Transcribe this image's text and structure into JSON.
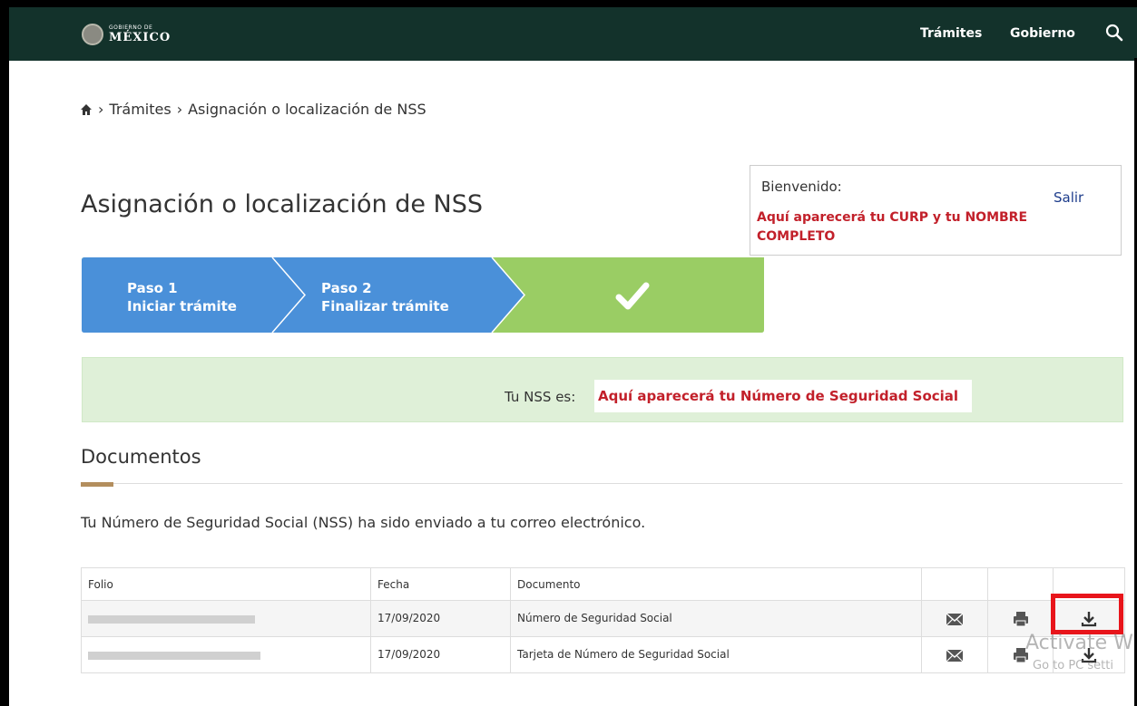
{
  "header": {
    "logo_small": "GOBIERNO DE",
    "logo_big": "MÉXICO",
    "nav": [
      "Trámites",
      "Gobierno"
    ],
    "search_icon": "search-icon",
    "colors": {
      "navbar": "#13322b",
      "accent": "#b38e5d"
    }
  },
  "breadcrumb": {
    "home_icon": "home-icon",
    "items": [
      "Trámites",
      "Asignación o localización de NSS"
    ]
  },
  "page": {
    "title": "Asignación o localización de NSS"
  },
  "welcome": {
    "label": "Bienvenido:",
    "logout": "Salir",
    "placeholder": "Aquí aparecerá tu CURP y tu NOMBRE COMPLETO"
  },
  "stepper": {
    "steps": [
      {
        "number": "Paso 1",
        "label": "Iniciar trámite",
        "color": "#4a90d9"
      },
      {
        "number": "Paso 2",
        "label": "Finalizar trámite",
        "color": "#4a90d9"
      },
      {
        "label": "",
        "icon": "checkmark-icon",
        "color": "#9acd64"
      }
    ]
  },
  "nss": {
    "label": "Tu NSS es:",
    "value_placeholder": "Aquí aparecerá tu Número de Seguridad Social"
  },
  "documents": {
    "title": "Documentos",
    "notice": "Tu Número de Seguridad Social (NSS) ha sido enviado a tu correo electrónico.",
    "headers": [
      "Folio",
      "Fecha",
      "Documento"
    ],
    "rows": [
      {
        "folio": "",
        "fecha": "17/09/2020",
        "documento": "Número de Seguridad Social"
      },
      {
        "folio": "",
        "fecha": "17/09/2020",
        "documento": "Tarjeta de Número de Seguridad Social"
      }
    ],
    "action_icons": [
      "mail-icon",
      "print-icon",
      "download-icon"
    ]
  },
  "watermark": {
    "line1": "Activate W",
    "line2": "Go to PC setti"
  }
}
